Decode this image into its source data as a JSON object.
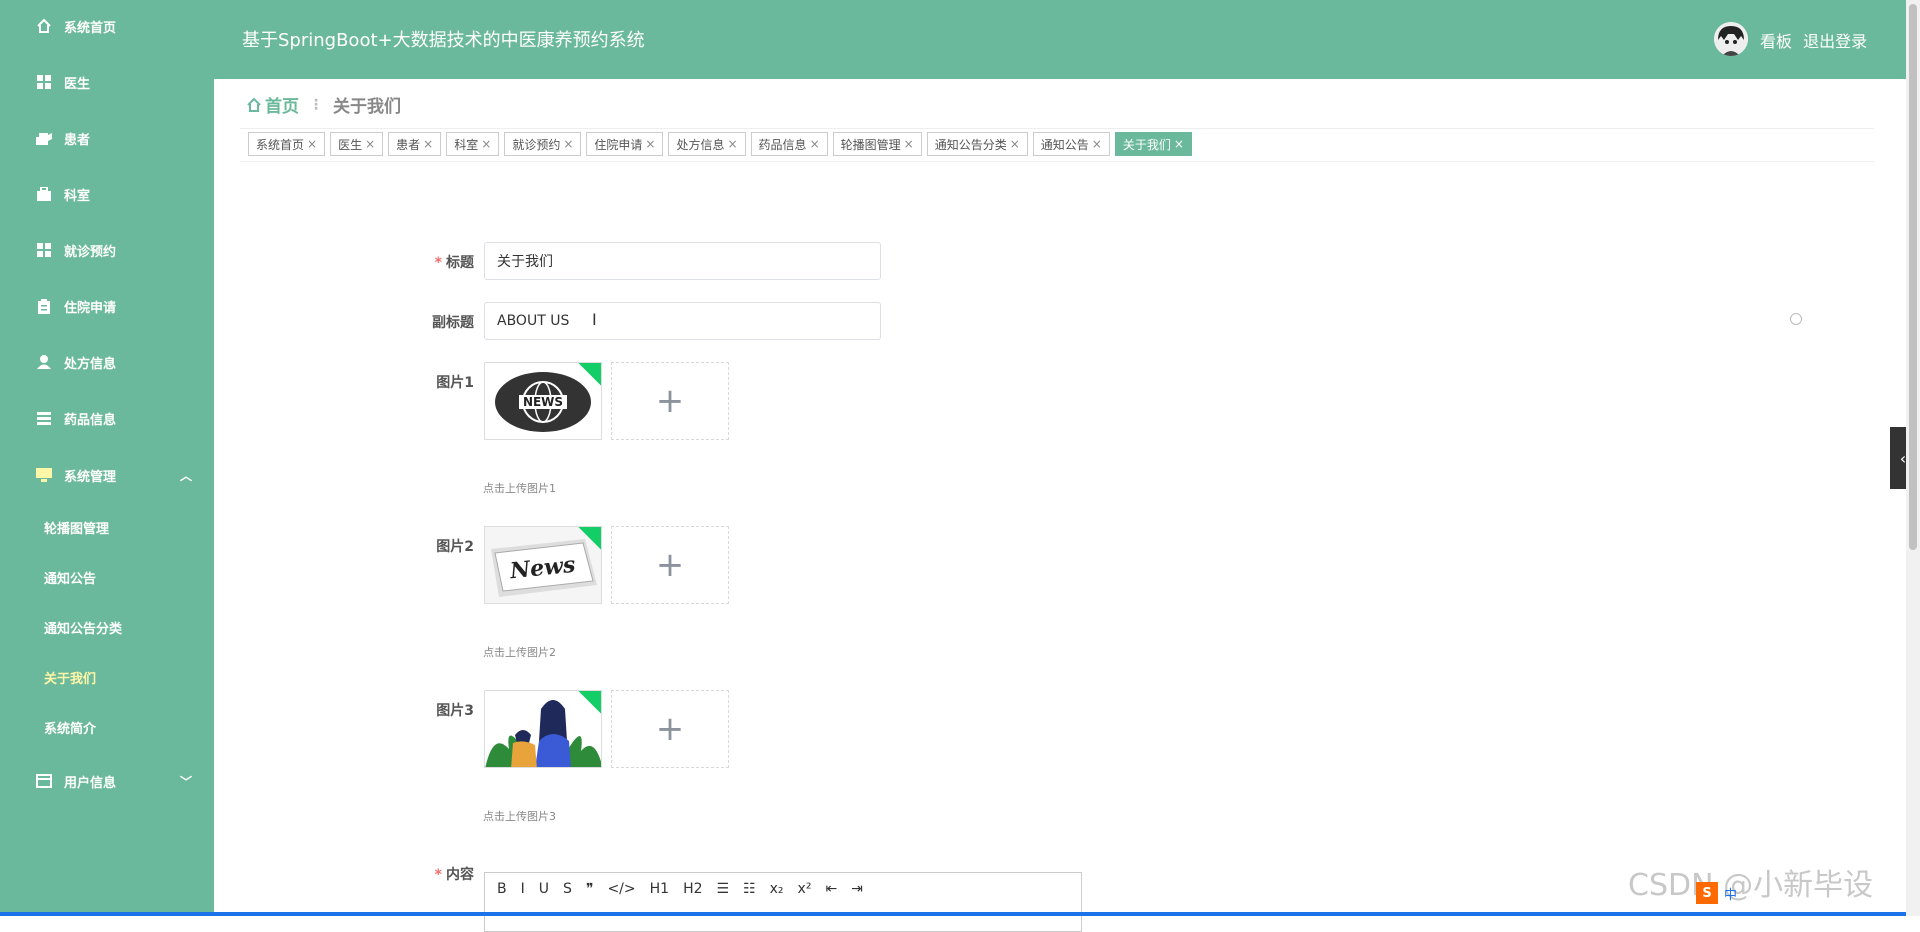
{
  "app": {
    "title": "基于SpringBoot+大数据技术的中医康养预约系统"
  },
  "header": {
    "links": [
      "看板",
      "退出登录"
    ]
  },
  "sidebar": {
    "items": [
      {
        "label": "系统首页",
        "icon": "home-icon"
      },
      {
        "label": "医生",
        "icon": "grid-icon"
      },
      {
        "label": "患者",
        "icon": "user-group-icon"
      },
      {
        "label": "科室",
        "icon": "briefcase-icon"
      },
      {
        "label": "就诊预约",
        "icon": "grid-icon"
      },
      {
        "label": "住院申请",
        "icon": "clipboard-icon"
      },
      {
        "label": "处方信息",
        "icon": "user-icon"
      },
      {
        "label": "药品信息",
        "icon": "list-icon"
      },
      {
        "label": "系统管理",
        "icon": "monitor-icon"
      },
      {
        "label": "用户信息",
        "icon": "card-icon"
      }
    ],
    "submenu": [
      "轮播图管理",
      "通知公告",
      "通知公告分类",
      "关于我们",
      "系统简介"
    ]
  },
  "breadcrumb": {
    "home": "首页",
    "current": "关于我们"
  },
  "tags": [
    "系统首页",
    "医生",
    "患者",
    "科室",
    "就诊预约",
    "住院申请",
    "处方信息",
    "药品信息",
    "轮播图管理",
    "通知公告分类",
    "通知公告",
    "关于我们"
  ],
  "form": {
    "title_label": "标题",
    "title_value": "关于我们",
    "subtitle_label": "副标题",
    "subtitle_value": "ABOUT US",
    "pic1_label": "图片1",
    "pic1_hint": "点击上传图片1",
    "pic2_label": "图片2",
    "pic2_hint": "点击上传图片2",
    "pic3_label": "图片3",
    "pic3_hint": "点击上传图片3",
    "content_label": "内容",
    "plus": "+"
  },
  "editor": {
    "toolbar": [
      "B",
      "I",
      "U",
      "S",
      "❞",
      "</>",
      "H1",
      "H2",
      "☰",
      "☷",
      "x₂",
      "x²",
      "⇤",
      "⇥"
    ]
  },
  "watermark": "CSDN @小新毕设",
  "ime": {
    "label": "中"
  },
  "colors": {
    "theme": "#6bb99c",
    "active_sub": "#fff7a8",
    "required": "#f56c6c"
  }
}
